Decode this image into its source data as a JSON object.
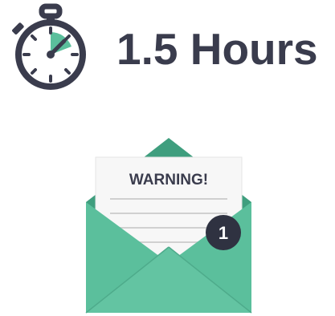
{
  "duration": {
    "label": "1.5 Hours"
  },
  "notification": {
    "warning_title": "WARNING!",
    "badge_count": "1"
  },
  "icons": {
    "timer": "stopwatch-icon",
    "mail": "open-envelope-icon"
  },
  "colors": {
    "dark": "#3a3c4d",
    "accent": "#5bbf9c",
    "accent_dark": "#3f9e7e",
    "paper": "#f7f7f7",
    "badge": "#2f3241"
  }
}
